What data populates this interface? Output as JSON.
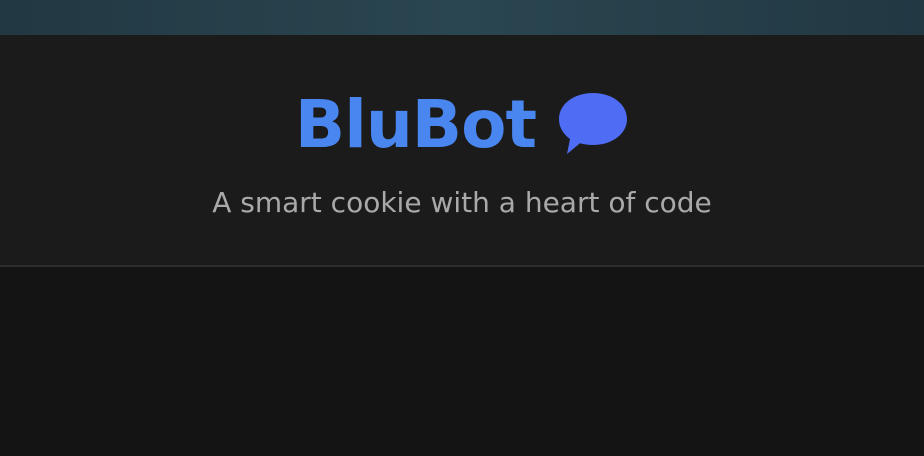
{
  "header": {
    "title": "BluBot",
    "title_icon": "speech-bubble-icon",
    "subtitle": "A smart cookie with a heart of code"
  },
  "colors": {
    "title": "#4a86f0",
    "icon": "#4f6cf5",
    "subtitle": "#a9a9a9",
    "header_bg": "#1b1b1b",
    "page_bg": "#141414",
    "top_strip": "#2a4650"
  }
}
